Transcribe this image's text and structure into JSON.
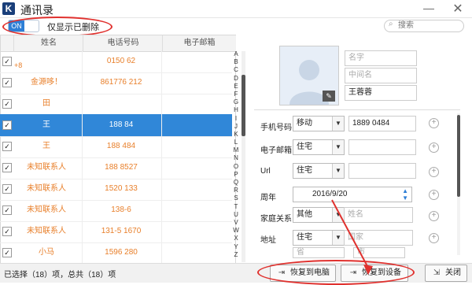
{
  "window": {
    "title": "通讯录",
    "app_icon": "K"
  },
  "toolbar": {
    "toggle_state": "ON",
    "toggle_label": "仅显示已删除",
    "search_placeholder": "搜索"
  },
  "table": {
    "headers": {
      "name": "姓名",
      "phone": "电话号码",
      "email": "电子邮箱"
    },
    "rows": [
      {
        "name": "",
        "name2": "+8",
        "phone": "0150      62",
        "checked": "✓",
        "selected": false
      },
      {
        "name": "金源哆！",
        "phone": "861776      212",
        "checked": "✓",
        "selected": false
      },
      {
        "name": "田",
        "phone": "",
        "checked": "✓",
        "selected": false
      },
      {
        "name": "王",
        "phone": "188      84",
        "checked": "✓",
        "selected": true
      },
      {
        "name": "王",
        "phone": "188      484",
        "checked": "✓",
        "selected": false
      },
      {
        "name": "未知联系人",
        "phone": "188      8527",
        "checked": "✓",
        "selected": false
      },
      {
        "name": "未知联系人",
        "phone": "1520      133",
        "checked": "✓",
        "selected": false
      },
      {
        "name": "未知联系人",
        "phone": "138-6",
        "checked": "✓",
        "selected": false
      },
      {
        "name": "未知联系人",
        "phone": "131-5      1670",
        "checked": "✓",
        "selected": false
      },
      {
        "name": "小马",
        "phone": "1596      280",
        "checked": "✓",
        "selected": false
      }
    ],
    "alphabet": [
      "A",
      "B",
      "C",
      "D",
      "E",
      "F",
      "G",
      "H",
      "I",
      "J",
      "K",
      "L",
      "M",
      "N",
      "O",
      "P",
      "Q",
      "R",
      "S",
      "T",
      "U",
      "V",
      "W",
      "X",
      "Y",
      "Z"
    ]
  },
  "detail": {
    "fields": {
      "surname_placeholder": "名字",
      "middle_placeholder": "中间名",
      "given_name": "王蓉蓉"
    },
    "labels": {
      "phone": "手机号码",
      "email": "电子邮箱",
      "url": "Url",
      "anniversary": "周年",
      "family": "家庭关系",
      "address": "地址"
    },
    "phone": {
      "type": "移动",
      "value": "1889      0484"
    },
    "email": {
      "type": "住宅"
    },
    "url": {
      "type": "住宅"
    },
    "anniversary": {
      "value": "2016/9/20"
    },
    "family": {
      "type": "其他",
      "placeholder": "姓名"
    },
    "address": {
      "type": "住宅",
      "country_placeholder": "国家",
      "province_placeholder": "省",
      "city_placeholder": "市"
    }
  },
  "footer": {
    "status": "已选择（18）项，总共（18）项",
    "restore_pc": "恢复到电脑",
    "restore_device": "恢复到设备",
    "close": "关闭"
  },
  "colors": {
    "selection": "#3087d8",
    "contact_text": "#e87f2a",
    "annotation": "#e0312e"
  }
}
